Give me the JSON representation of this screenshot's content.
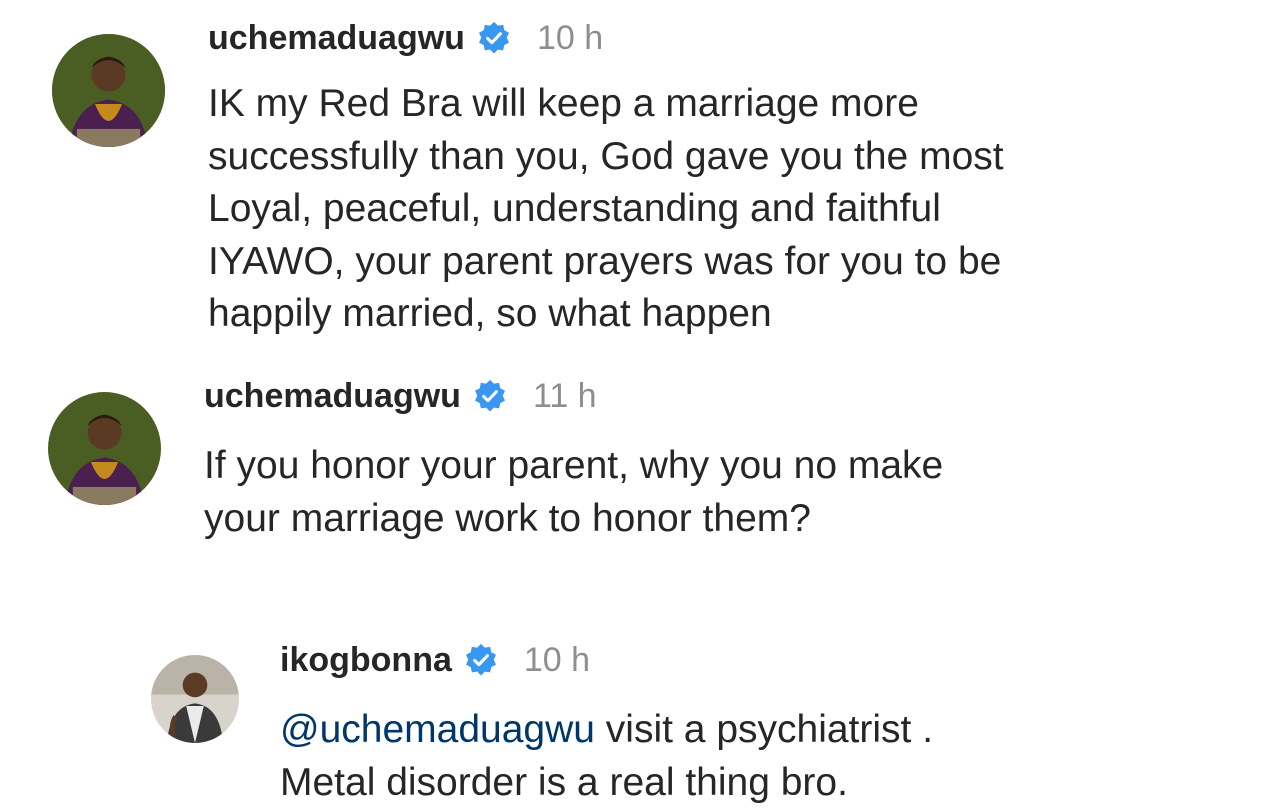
{
  "comments": [
    {
      "username": "uchemaduagwu",
      "verified": true,
      "time": "10 h",
      "text": "IK my Red Bra will keep a marriage more\nsuccessfully than you, God gave you the most\nLoyal, peaceful, understanding and faithful\nIYAWO, your parent prayers was for you to be\nhappily married, so what happen",
      "avatar_icon": "profile-photo"
    },
    {
      "username": "uchemaduagwu",
      "verified": true,
      "time": "11 h",
      "text": "If you honor your parent, why you no make\nyour marriage work to honor them?",
      "avatar_icon": "profile-photo"
    },
    {
      "username": "ikogbonna",
      "verified": true,
      "time": "10 h",
      "mention": "@uchemaduagwu",
      "text_after_mention": " visit a psychiatrist .\nMetal disorder is a real thing bro.",
      "avatar_icon": "profile-photo"
    }
  ],
  "colors": {
    "verified_badge": "#3897f0",
    "mention": "#00376b",
    "timestamp": "#8e8e8e",
    "text": "#262626"
  }
}
